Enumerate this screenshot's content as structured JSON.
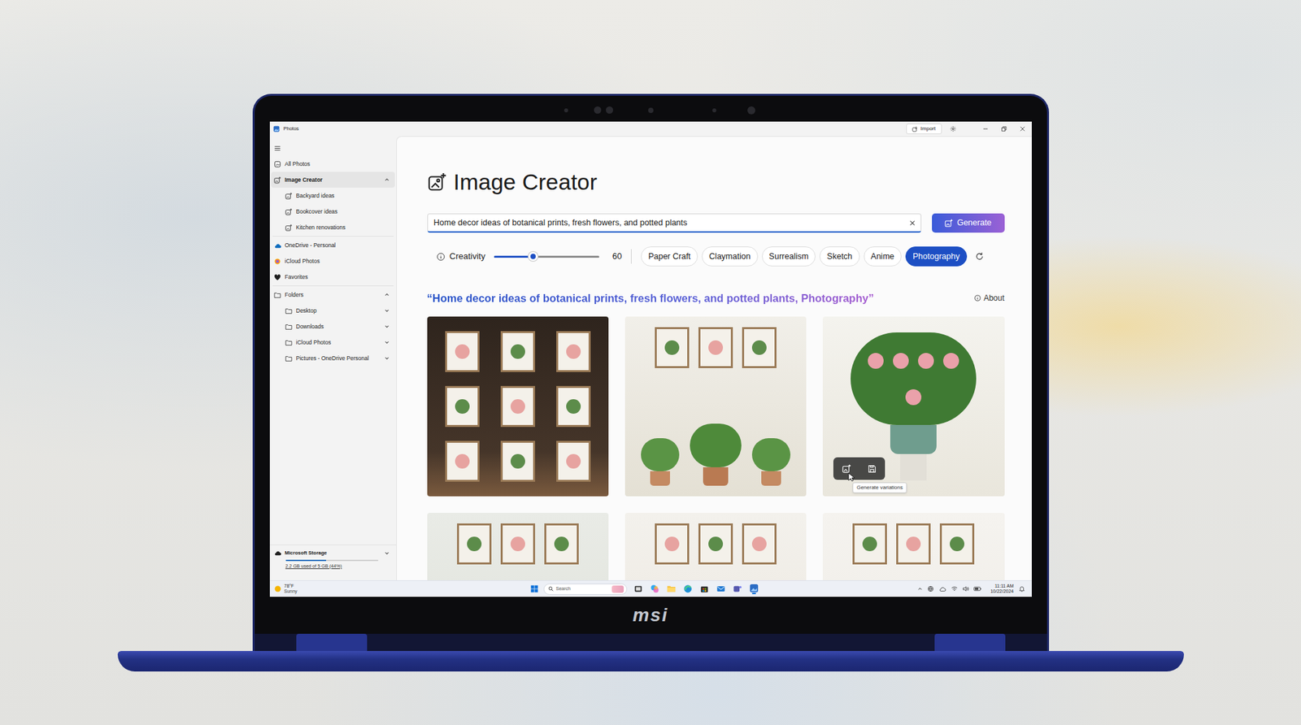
{
  "laptop": {
    "brand": "msi"
  },
  "window": {
    "title": "Photos",
    "import_button": "Import"
  },
  "sidebar": {
    "items": [
      {
        "label": "All Photos",
        "kind": "nav",
        "selected": false
      },
      {
        "label": "Image Creator",
        "kind": "group",
        "selected": true,
        "expanded": true
      },
      {
        "label": "Backyard ideas",
        "kind": "sub",
        "selected": false
      },
      {
        "label": "Bookcover ideas",
        "kind": "sub",
        "selected": false
      },
      {
        "label": "Kitchen renovations",
        "kind": "sub",
        "selected": false
      },
      {
        "label": "OneDrive - Personal",
        "kind": "nav",
        "selected": false
      },
      {
        "label": "iCloud Photos",
        "kind": "nav",
        "selected": false
      },
      {
        "label": "Favorites",
        "kind": "nav",
        "selected": false
      },
      {
        "label": "Folders",
        "kind": "group",
        "selected": false,
        "expanded": true
      },
      {
        "label": "Desktop",
        "kind": "folder",
        "selected": false,
        "expanded": false
      },
      {
        "label": "Downloads",
        "kind": "folder",
        "selected": false,
        "expanded": false
      },
      {
        "label": "iCloud Photos",
        "kind": "folder",
        "selected": false,
        "expanded": false
      },
      {
        "label": "Pictures - OneDrive Personal",
        "kind": "folder",
        "selected": false,
        "expanded": false
      }
    ],
    "storage": {
      "title": "Microsoft Storage",
      "usage": "2.2 GB used of 5 GB (44%)",
      "level": 0.44
    }
  },
  "creator": {
    "title": "Image Creator",
    "prompt": "Home decor ideas of botanical prints, fresh flowers, and potted plants",
    "generate": "Generate",
    "creativity": {
      "label": "Creativity",
      "level": 0.37,
      "reading": "60"
    },
    "styles": [
      {
        "label": "Paper Craft",
        "selected": false
      },
      {
        "label": "Claymation",
        "selected": false
      },
      {
        "label": "Surrealism",
        "selected": false
      },
      {
        "label": "Sketch",
        "selected": false
      },
      {
        "label": "Anime",
        "selected": false
      },
      {
        "label": "Photography",
        "selected": true
      }
    ],
    "result": {
      "open": "“",
      "prompt": "Home decor ideas of botanical prints, fresh flowers, and potted plants, ",
      "style": "Photography",
      "close": "”"
    },
    "about": "About",
    "images": [
      {
        "hovered": false
      },
      {
        "hovered": false
      },
      {
        "hovered": true
      },
      {
        "hovered": false
      },
      {
        "hovered": false
      },
      {
        "hovered": false
      }
    ],
    "tooltip": "Generate variations"
  },
  "taskbar": {
    "weather": {
      "temp": "78°F",
      "condition": "Sunny"
    },
    "search": "Search",
    "time": "11:11 AM",
    "date": "10/22/2024"
  }
}
